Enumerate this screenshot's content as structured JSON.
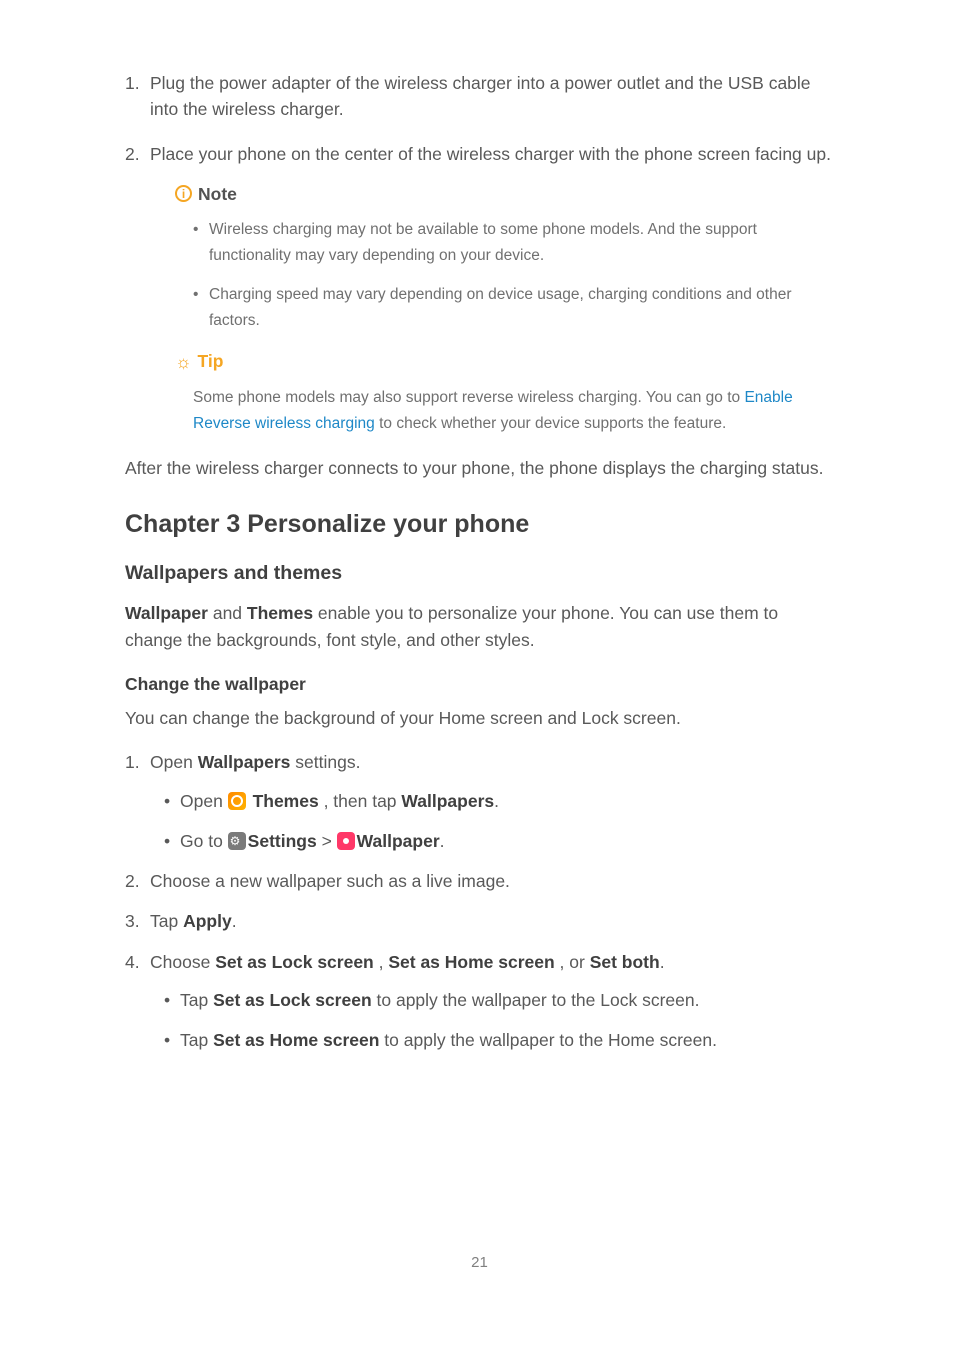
{
  "steps_top": [
    "Plug the power adapter of the wireless charger into a power outlet and the USB cable into the wireless charger.",
    "Place your phone on the center of the wireless charger with the phone screen facing up."
  ],
  "note": {
    "label": "Note",
    "items": [
      "Wireless charging may not be available to some phone models. And the support functionality may vary depending on your device.",
      "Charging speed may vary depending on device usage, charging conditions and other factors."
    ]
  },
  "tip": {
    "label": "Tip",
    "pre": "Some phone models may also support reverse wireless charging. You can go to ",
    "link": "Enable Reverse wireless charging",
    "post": " to check whether your device supports the feature."
  },
  "after_para": "After the wireless charger connects to your phone, the phone displays the charging status.",
  "chapter_title": "Chapter 3 Personalize your phone",
  "section_title": "Wallpapers and themes",
  "section_intro": {
    "b1": "Wallpaper",
    "mid1": " and ",
    "b2": "Themes",
    "rest": " enable you to personalize your phone. You can use them to change the backgrounds, font style, and other styles."
  },
  "subhead": "Change the wallpaper",
  "sub_intro": "You can change the background of your Home screen and Lock screen.",
  "steps_main": {
    "s1": {
      "pre": "Open ",
      "b": "Wallpapers",
      "post": " settings."
    },
    "s1_bullets": {
      "a": {
        "pre": "Open ",
        "b1": "Themes",
        "mid": " , then tap ",
        "b2": "Wallpapers",
        "post": "."
      },
      "b": {
        "pre": "Go to ",
        "b1": "Settings",
        "mid": " > ",
        "b2": "Wallpaper",
        "post": "."
      }
    },
    "s2": "Choose a new wallpaper such as a live image.",
    "s3": {
      "pre": "Tap ",
      "b": "Apply",
      "post": "."
    },
    "s4": {
      "pre": "Choose ",
      "b1": "Set as Lock screen",
      "c1": " , ",
      "b2": "Set as Home screen",
      "c2": " , or ",
      "b3": "Set both",
      "post": "."
    },
    "s4_bullets": {
      "a": {
        "pre": "Tap ",
        "b": "Set as Lock screen",
        "post": " to apply the wallpaper to the Lock screen."
      },
      "b": {
        "pre": "Tap ",
        "b": "Set as Home screen",
        "post": " to apply the wallpaper to the Home screen."
      }
    }
  },
  "page_number": "21"
}
